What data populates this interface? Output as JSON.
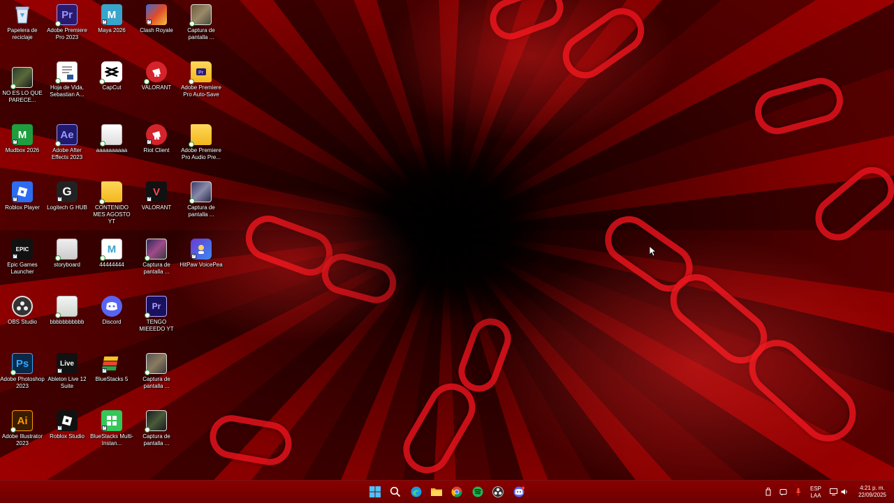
{
  "desktop": {
    "icons": [
      {
        "label": "Papelera de reciclaje",
        "icon": "recycle-bin-icon"
      },
      {
        "label": "Adobe Premiere Pro 2023",
        "icon": "premiere-pro-icon",
        "glyph": "Pr"
      },
      {
        "label": "Maya 2026",
        "icon": "maya-icon",
        "glyph": "M"
      },
      {
        "label": "Clash Royale",
        "icon": "clash-royale-icon"
      },
      {
        "label": "Captura de pantalla ...",
        "icon": "screenshot-thumbnail-icon"
      },
      {
        "label": "NO ES LO QUE PARECE...",
        "icon": "video-thumbnail-icon"
      },
      {
        "label": "Hoja de Vida, Sebastian A...",
        "icon": "word-document-icon"
      },
      {
        "label": "CapCut",
        "icon": "capcut-icon"
      },
      {
        "label": "VALORANT",
        "icon": "valorant-riot-icon"
      },
      {
        "label": "Adobe Premiere Pro Auto-Save",
        "icon": "folder-icon"
      },
      {
        "label": "Mudbox 2026",
        "icon": "mudbox-icon",
        "glyph": "M"
      },
      {
        "label": "Adobe After Effects 2023",
        "icon": "after-effects-icon",
        "glyph": "Ae"
      },
      {
        "label": "aaaaaaaaaa",
        "icon": "image-file-icon"
      },
      {
        "label": "Riot Client",
        "icon": "riot-client-icon"
      },
      {
        "label": "Adobe Premiere Pro Audio Pre...",
        "icon": "folder-icon"
      },
      {
        "label": "Roblox Player",
        "icon": "roblox-player-icon"
      },
      {
        "label": "Logitech G HUB",
        "icon": "logitech-g-hub-icon",
        "glyph": "G"
      },
      {
        "label": "CONTENIDO MES AGOSTO YT",
        "icon": "folder-icon"
      },
      {
        "label": "VALORANT",
        "icon": "valorant-icon",
        "glyph": "V"
      },
      {
        "label": "Captura de pantalla ...",
        "icon": "screenshot-thumbnail-icon"
      },
      {
        "label": "Epic Games Launcher",
        "icon": "epic-games-icon",
        "glyph": "EPIC"
      },
      {
        "label": "storyboard",
        "icon": "image-file-icon"
      },
      {
        "label": "44444444",
        "icon": "maya-file-icon",
        "glyph": "M"
      },
      {
        "label": "Captura de pantalla ...",
        "icon": "screenshot-thumbnail-icon"
      },
      {
        "label": "HitPaw VoicePea",
        "icon": "hitpaw-icon"
      },
      {
        "label": "OBS Studio",
        "icon": "obs-studio-icon"
      },
      {
        "label": "bbbbbbbbbbb",
        "icon": "image-file-icon"
      },
      {
        "label": "Discord",
        "icon": "discord-icon"
      },
      {
        "label": "TENGO MIEEEDO YT",
        "icon": "premiere-project-icon",
        "glyph": "Pr"
      },
      {
        "label": "Adobe Photoshop 2023",
        "icon": "photoshop-icon",
        "glyph": "Ps"
      },
      {
        "label": "Ableton Live 12 Suite",
        "icon": "ableton-icon",
        "glyph": "Live"
      },
      {
        "label": "BlueStacks 5",
        "icon": "bluestacks-icon"
      },
      {
        "label": "Captura de pantalla ...",
        "icon": "screenshot-thumbnail-icon"
      },
      {
        "label": "Adobe Illustrator 2023",
        "icon": "illustrator-icon",
        "glyph": "Ai"
      },
      {
        "label": "Roblox Studio",
        "icon": "roblox-studio-icon"
      },
      {
        "label": "BlueStacks Multi-Instan...",
        "icon": "bluestacks-multi-icon"
      },
      {
        "label": "Captura de pantalla ...",
        "icon": "screenshot-thumbnail-icon"
      }
    ]
  },
  "taskbar": {
    "apps": [
      "windows-start-icon",
      "search-icon",
      "edge-icon",
      "file-explorer-icon",
      "chrome-icon",
      "spotify-icon",
      "obs-icon",
      "discord-icon"
    ],
    "tray": {
      "language_line1": "ESP",
      "language_line2": "LAA",
      "time": "4:21 p. m.",
      "date": "22/09/2025"
    }
  },
  "colors": {
    "taskbar": "#7a0000",
    "wallpaper_red": "#d10a12",
    "premiere": "#2a1a6e",
    "after_effects": "#1f1a6e",
    "photoshop": "#0a2a4a",
    "illustrator": "#3a1d00",
    "discord": "#5865f2",
    "valorant_riot": "#d4232b",
    "mudbox": "#1e9e3e",
    "maya": "#37a5cc"
  }
}
